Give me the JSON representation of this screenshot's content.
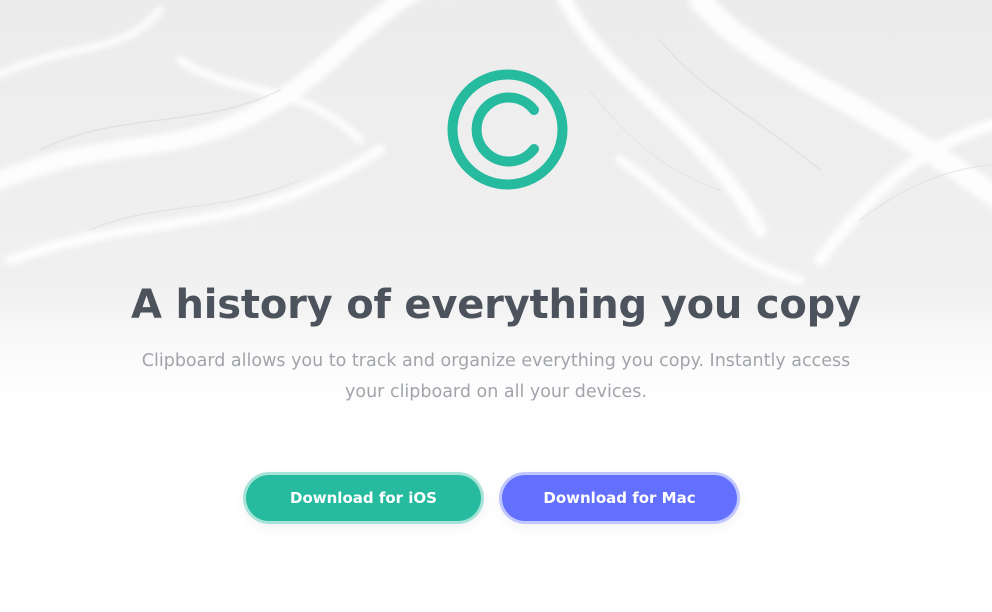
{
  "hero": {
    "logo_icon": "copyright-icon",
    "title": "A history of everything you copy",
    "subtitle": "Clipboard allows you to track and organize everything you copy. Instantly access your clipboard on all your devices.",
    "buttons": {
      "ios_label": "Download for iOS",
      "mac_label": "Download for Mac"
    }
  },
  "colors": {
    "accent_teal": "#26ba9f",
    "accent_blue": "#6370fe",
    "title_text": "#4c535d",
    "subtitle_text": "#a1a5ab"
  }
}
